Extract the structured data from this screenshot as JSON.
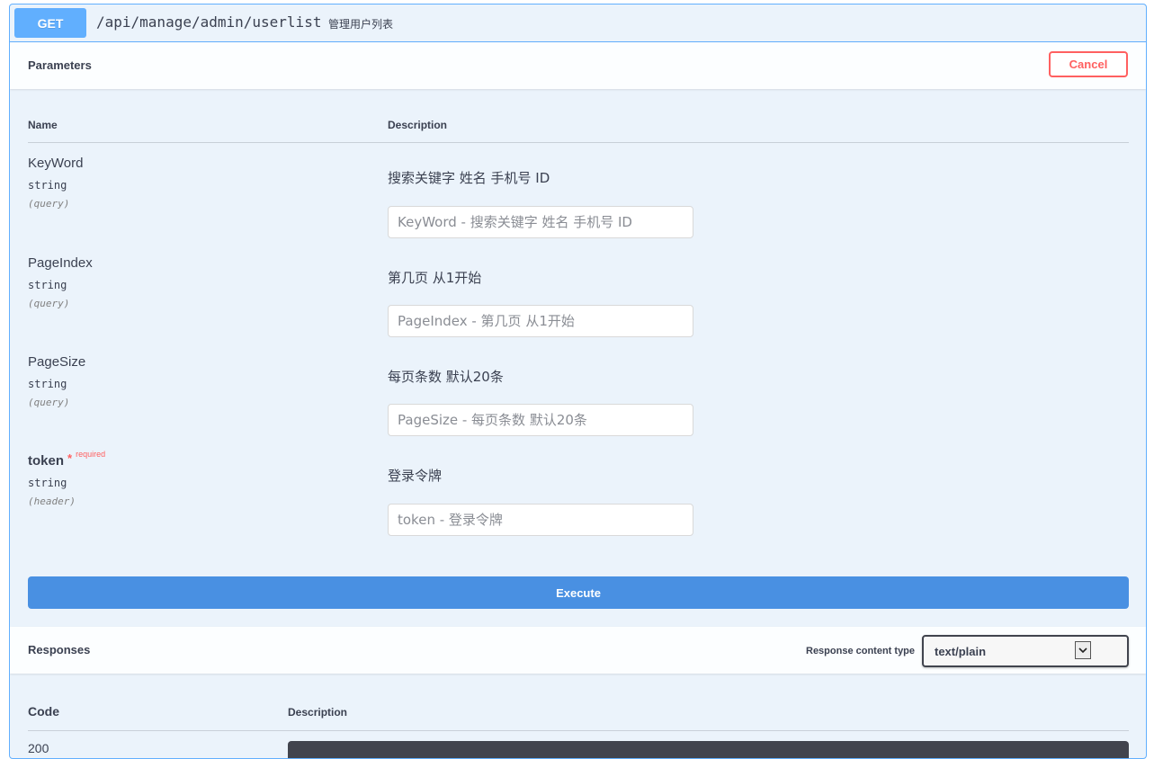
{
  "operation": {
    "method": "GET",
    "path": "/api/manage/admin/userlist",
    "summary": "管理用户列表"
  },
  "parameters_section": {
    "title": "Parameters",
    "cancel_label": "Cancel",
    "col_name": "Name",
    "col_description": "Description",
    "items": [
      {
        "name": "KeyWord",
        "type": "string",
        "in": "(query)",
        "description": "搜索关键字 姓名 手机号 ID",
        "placeholder": "KeyWord - 搜索关键字 姓名 手机号 ID",
        "value": ""
      },
      {
        "name": "PageIndex",
        "type": "string",
        "in": "(query)",
        "description": "第几页 从1开始",
        "placeholder": "PageIndex - 第几页 从1开始",
        "value": ""
      },
      {
        "name": "PageSize",
        "type": "string",
        "in": "(query)",
        "description": "每页条数 默认20条",
        "placeholder": "PageSize - 每页条数 默认20条",
        "value": ""
      },
      {
        "name": "token",
        "required_mark": "*",
        "required_text": "required",
        "type": "string",
        "in": "(header)",
        "description": "登录令牌",
        "placeholder": "token - 登录令牌",
        "value": ""
      }
    ],
    "execute_label": "Execute"
  },
  "responses_section": {
    "title": "Responses",
    "content_type_label": "Response content type",
    "content_type_value": "text/plain",
    "col_code": "Code",
    "col_description": "Description",
    "first_code": "200"
  },
  "colors": {
    "get_accent": "#61affe",
    "execute": "#4990e2",
    "cancel": "#ff6060",
    "background": "#ebf3fb"
  },
  "icons": {
    "select_arrow": "chevron-down-icon"
  }
}
